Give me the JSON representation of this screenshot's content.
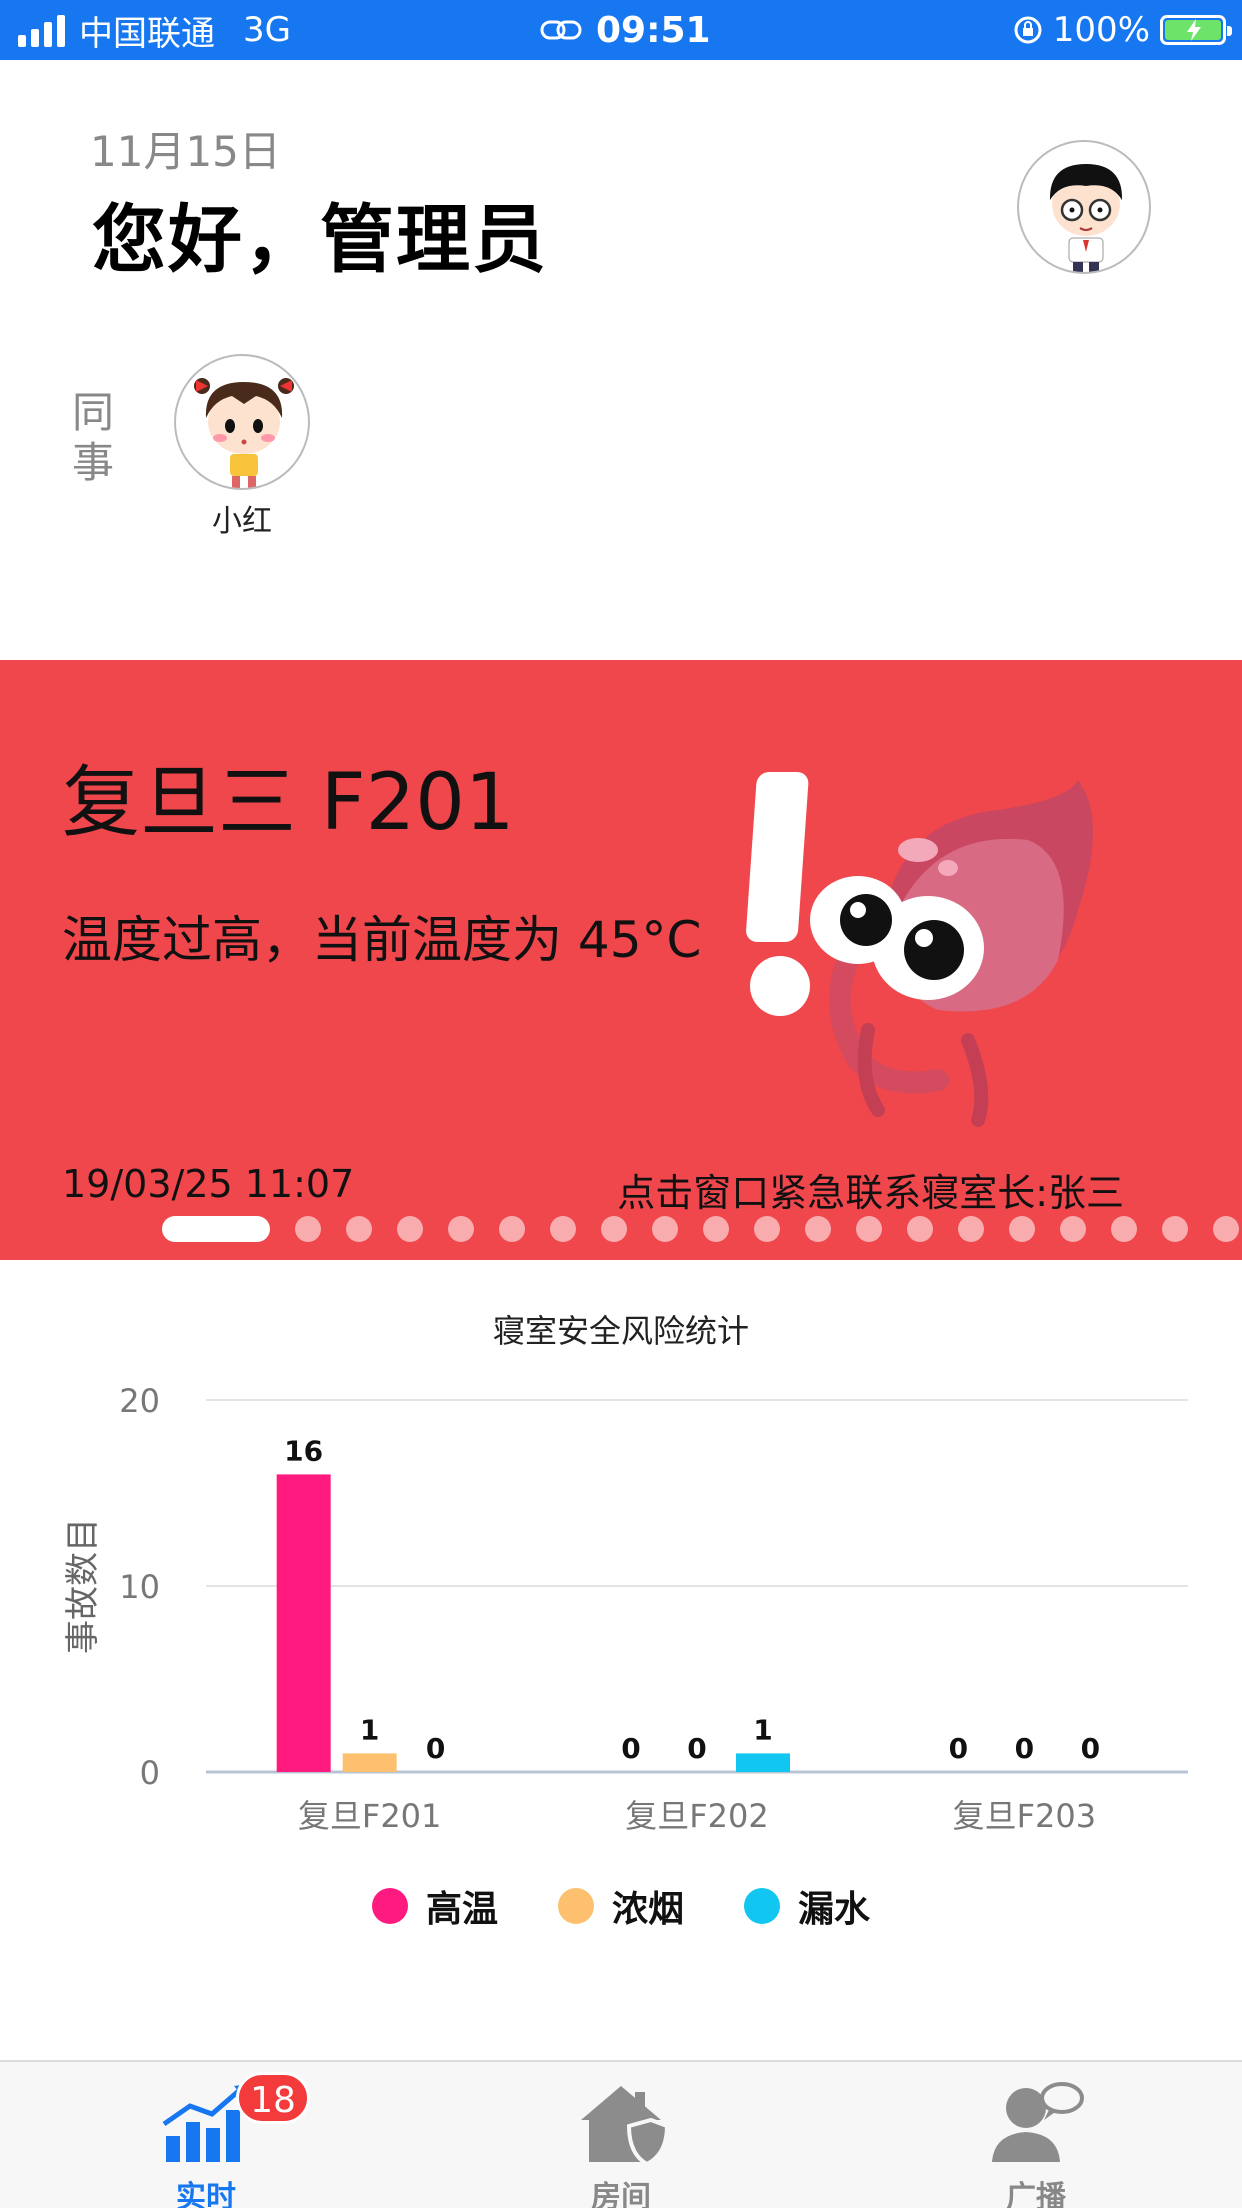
{
  "status_bar": {
    "carrier": "中国联通",
    "network": "3G",
    "time": "09:51",
    "battery": "100%"
  },
  "header": {
    "date": "11月15日",
    "greeting": "您好，管理员"
  },
  "colleagues": {
    "label": "同事",
    "items": [
      {
        "name": "小红"
      }
    ]
  },
  "alert": {
    "room": "复旦三 F201",
    "message": "温度过高，当前温度为 45°C",
    "time": "19/03/25 11:07",
    "contact": "点击窗口紧急联系寝室长:张三",
    "page_count": 20,
    "active_page": 0,
    "color": "#f0474d"
  },
  "chart_data": {
    "type": "bar",
    "title": "寝室安全风险统计",
    "ylabel": "事故数目",
    "xlabel": "",
    "ylim": [
      0,
      20
    ],
    "yticks": [
      0,
      10,
      20
    ],
    "categories": [
      "复旦F201",
      "复旦F202",
      "复旦F203"
    ],
    "series": [
      {
        "name": "高温",
        "color": "#ff1a7f",
        "values": [
          16,
          0,
          0
        ]
      },
      {
        "name": "浓烟",
        "color": "#fcc06e",
        "values": [
          1,
          0,
          0
        ]
      },
      {
        "name": "漏水",
        "color": "#11c6f0",
        "values": [
          0,
          1,
          0
        ]
      }
    ],
    "grid": true,
    "legend_position": "bottom"
  },
  "tab_bar": {
    "tabs": [
      {
        "label": "实时",
        "icon": "chart-icon",
        "active": true
      },
      {
        "label": "房间",
        "icon": "house-shield-icon",
        "active": false
      },
      {
        "label": "广播",
        "icon": "person-speech-icon",
        "active": false
      }
    ],
    "badge": "18",
    "active_color": "#1677f0"
  }
}
